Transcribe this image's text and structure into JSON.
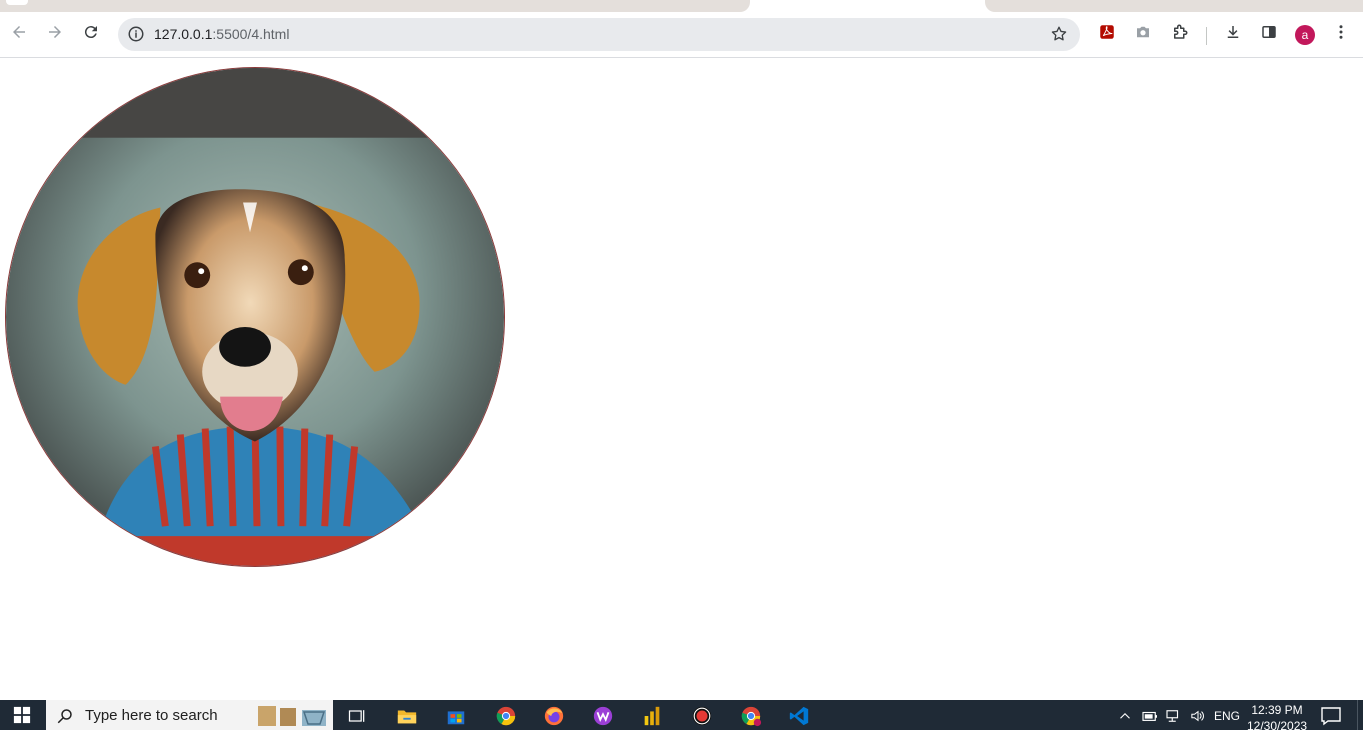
{
  "browser": {
    "url_host": "127.0.0.1",
    "url_path": ":5500/4.html",
    "profile_initial": "a",
    "icons": {
      "back": "arrow-left-icon",
      "forward": "arrow-right-icon",
      "reload": "reload-icon",
      "site_info": "info-icon",
      "bookmark": "star-icon",
      "extensions": [
        "pdf-icon",
        "camera-icon",
        "puzzle-icon"
      ],
      "download": "download-icon",
      "side_panel": "side-panel-icon",
      "menu": "kebab-menu-icon"
    },
    "accent_color": "#c2185b"
  },
  "page": {
    "image": "dog-in-sweater-photo"
  },
  "taskbar": {
    "search_placeholder": "Type here to search",
    "apps": [
      "task-view-icon",
      "file-explorer-icon",
      "store-icon",
      "chrome-icon",
      "firefox-icon",
      "wps-icon",
      "power-bi-icon",
      "record-icon",
      "chrome-profile-icon",
      "vscode-icon"
    ],
    "language": "ENG",
    "time": "12:39 PM",
    "date": "12/30/2023"
  }
}
